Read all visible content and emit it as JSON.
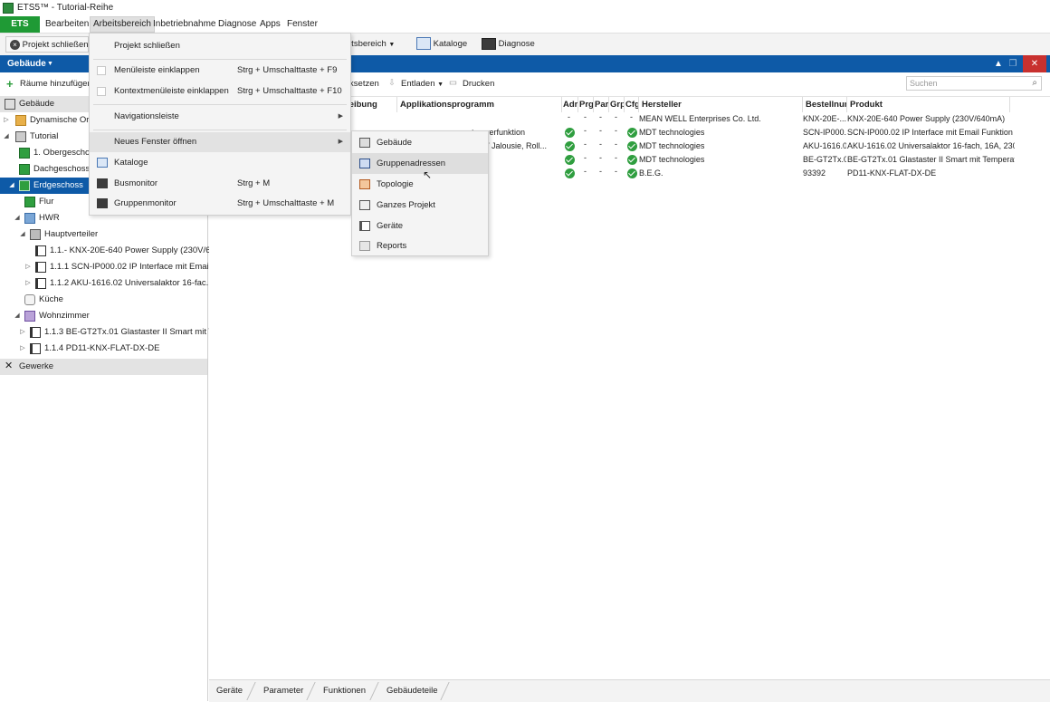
{
  "window": {
    "title": "ETS5™ - Tutorial-Reihe"
  },
  "menubar": {
    "ets": "ETS",
    "items": [
      "Bearbeiten",
      "Arbeitsbereich",
      "Inbetriebnahme",
      "Diagnose",
      "Apps",
      "Fenster"
    ]
  },
  "toolbar": {
    "close_project": "Projekt schließen",
    "workspace": "Arbeitsbereich",
    "catalogs": "Kataloge",
    "diagnose": "Diagnose"
  },
  "left_panel": {
    "header": "Gebäude",
    "add_rooms": "Räume hinzufügen",
    "tree": [
      "Gebäude",
      "Dynamische Ordner",
      "Tutorial",
      "1. Obergeschoss",
      "Dachgeschoss",
      "Erdgeschoss",
      "Flur",
      "HWR",
      "Hauptverteiler",
      "1.1.- KNX-20E-640 Power Supply (230V/6...",
      "1.1.1 SCN-IP000.02 IP Interface mit Email...",
      "1.1.2 AKU-1616.02 Universalaktor 16-fac...",
      "Küche",
      "Wohnzimmer",
      "1.1.3 BE-GT2Tx.01 Glastaster II Smart mit T...",
      "1.1.4 PD11-KNX-FLAT-DX-DE",
      "Gewerke"
    ]
  },
  "right_panel": {
    "toolbar": {
      "reset": "ücksetzen",
      "unload": "Entladen",
      "print": "Drucken",
      "search_placeholder": "Suchen"
    },
    "columns": [
      "reibung",
      "Applikationsprogramm",
      "Adr",
      "Prg",
      "Par",
      "Grp",
      "Cfg",
      "Hersteller",
      "Bestellnum",
      "Produkt"
    ],
    "rows": [
      {
        "app": "",
        "flags": [
          "-",
          "-",
          "-",
          "-",
          "-"
        ],
        "manufacturer": "MEAN WELL Enterprises Co. Ltd.",
        "order": "KNX-20E-...",
        "product": "KNX-20E-640 Power Supply (230V/640mA)"
      },
      {
        "app": "tserverfunktion",
        "flags": [
          "ok",
          "-",
          "-",
          "-",
          "ok"
        ],
        "manufacturer": "MDT technologies",
        "order": "SCN-IP000...",
        "product": "SCN-IP000.02 IP Interface mit Email Funktion"
      },
      {
        "app": "ach / Jalousie, Roll...",
        "flags": [
          "ok",
          "-",
          "-",
          "-",
          "ok"
        ],
        "manufacturer": "MDT technologies",
        "order": "AKU-1616.02",
        "product": "AKU-1616.02 Universalaktor 16-fach, 16A, 230..."
      },
      {
        "app": "ratur",
        "flags": [
          "ok",
          "-",
          "-",
          "-",
          "ok"
        ],
        "manufacturer": "MDT technologies",
        "order": "BE-GT2Tx.01",
        "product": "BE-GT2Tx.01 Glastaster II Smart mit Temperat..."
      },
      {
        "app": "",
        "flags": [
          "ok",
          "-",
          "-",
          "-",
          "ok"
        ],
        "manufacturer": "B.E.G.",
        "order": "93392",
        "product": "PD11-KNX-FLAT-DX-DE"
      }
    ]
  },
  "bottom_tabs": [
    "Geräte",
    "Parameter",
    "Funktionen",
    "Gebäudeteile"
  ],
  "dropdown": {
    "items": [
      {
        "label": "Projekt schließen",
        "shortcut": ""
      },
      {
        "label": "Menüleiste einklappen",
        "shortcut": "Strg + Umschalttaste + F9"
      },
      {
        "label": "Kontextmenüleiste einklappen",
        "shortcut": "Strg + Umschalttaste + F10"
      },
      {
        "label": "Navigationsleiste",
        "shortcut": ""
      },
      {
        "label": "Neues Fenster öffnen",
        "shortcut": ""
      },
      {
        "label": "Kataloge",
        "shortcut": ""
      },
      {
        "label": "Busmonitor",
        "shortcut": "Strg + M"
      },
      {
        "label": "Gruppenmonitor",
        "shortcut": "Strg + Umschalttaste + M"
      }
    ]
  },
  "submenu": {
    "items": [
      "Gebäude",
      "Gruppenadressen",
      "Topologie",
      "Ganzes Projekt",
      "Geräte",
      "Reports"
    ]
  }
}
